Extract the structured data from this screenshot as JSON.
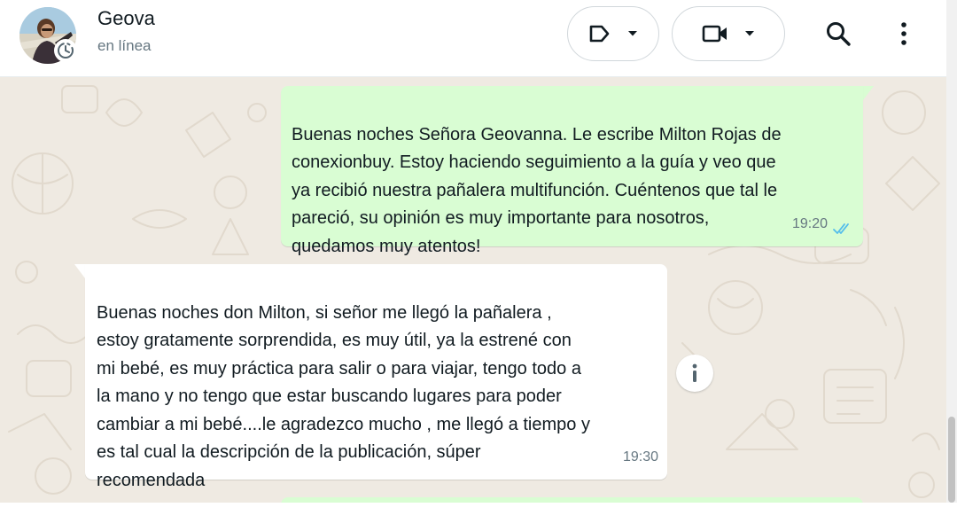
{
  "header": {
    "contact_name": "Geova",
    "contact_status": "en línea"
  },
  "icons": {
    "avatar": "contact-photo",
    "status": "status-ring-icon",
    "label": "label-tag-icon",
    "video": "video-camera-icon",
    "dropdown": "chevron-down-icon",
    "search": "search-icon",
    "menu": "more-vertical-icon",
    "ticks": "double-check-read-icon",
    "info": "info-icon"
  },
  "messages": [
    {
      "direction": "outgoing",
      "text": "Buenas noches Señora Geovanna. Le escribe Milton Rojas de\nconexionbuy. Estoy haciendo seguimiento a la guía y veo que\nya recibió nuestra pañalera multifunción. Cuéntenos que tal le\npareció, su opinión es muy importante para nosotros,\nquedamos muy atentos!",
      "time": "19:20",
      "status": "read"
    },
    {
      "direction": "incoming",
      "text": "Buenas noches don Milton, si señor me llegó la pañalera ,\nestoy gratamente sorprendida, es muy útil, ya la estrené con\nmi bebé, es muy práctica para salir o para viajar, tengo todo a\nla mano y no tengo que estar buscando lugares para poder\ncambiar a mi bebé....le agradezco mucho , me llegó a tiempo y\nes tal cual la descripción de la publicación, súper\nrecomendada",
      "time": "19:30"
    }
  ],
  "colors": {
    "outgoing_bubble": "#d9fdd3",
    "incoming_bubble": "#ffffff",
    "chat_background": "#efeae2",
    "read_ticks": "#53bdeb",
    "primary_text": "#111b21",
    "secondary_text": "#667781"
  }
}
